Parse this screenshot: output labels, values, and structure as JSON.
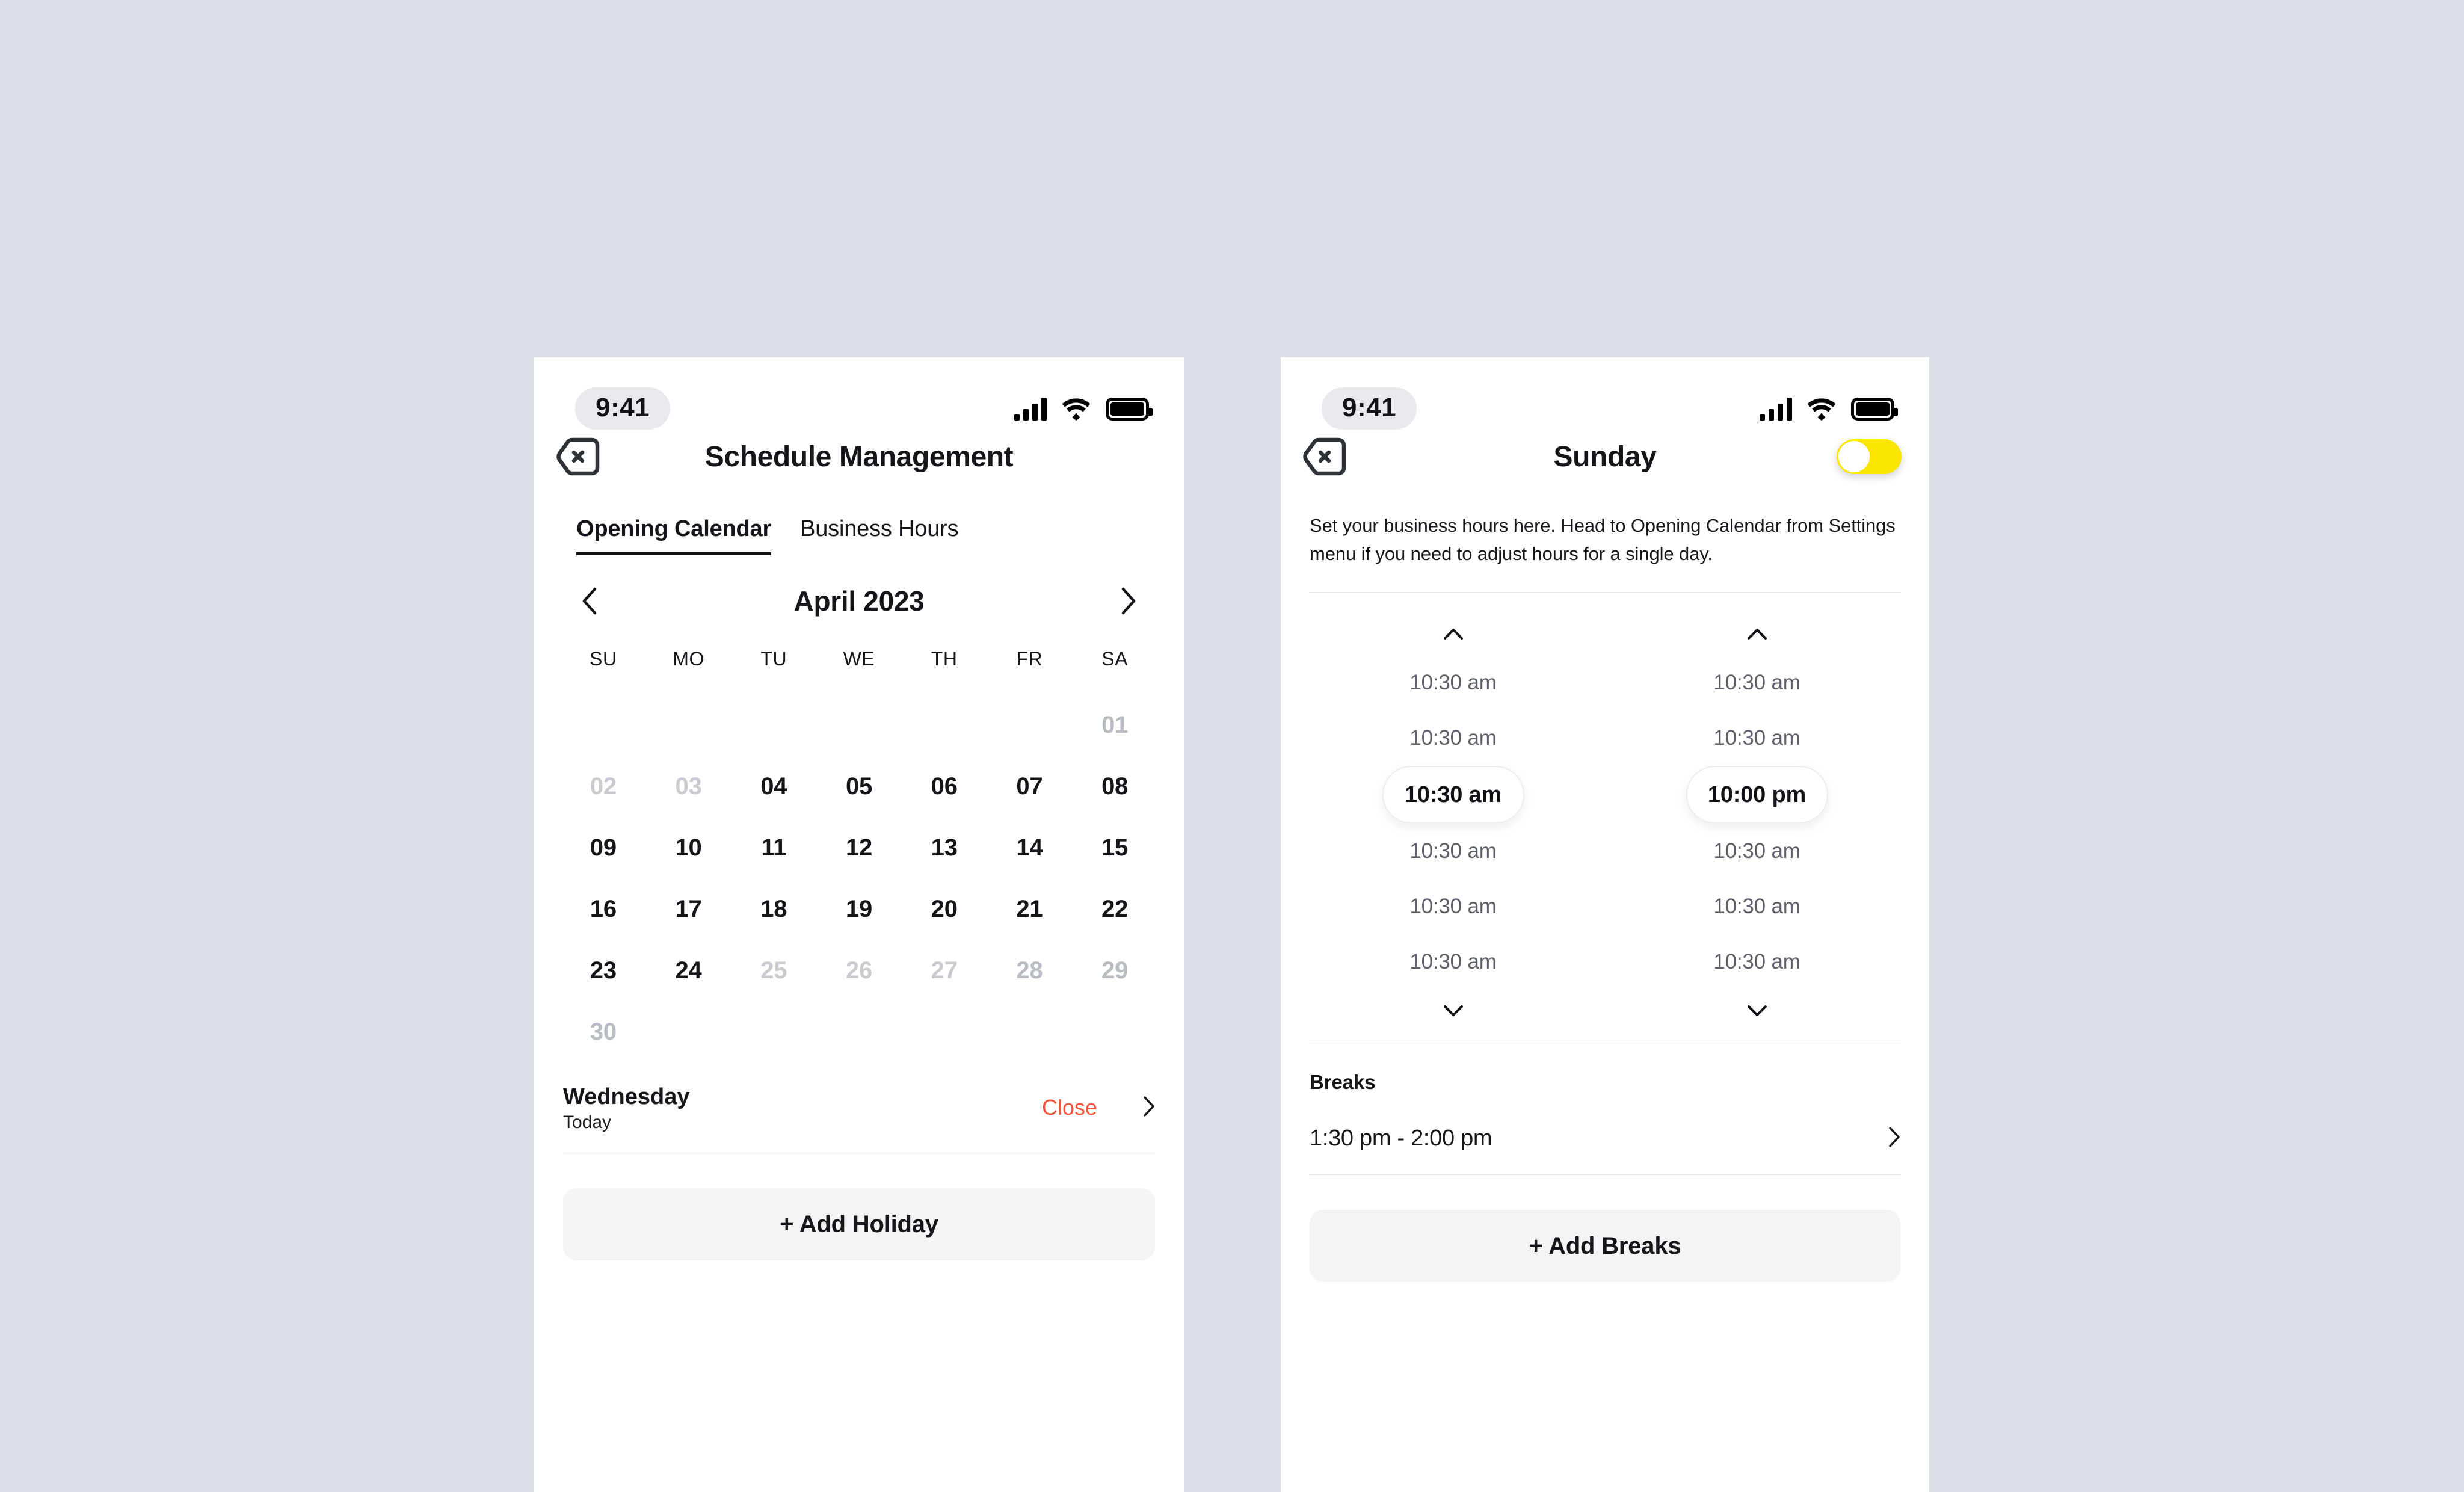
{
  "theme": {
    "background": "#dcdfe6",
    "panel": "#ffffff",
    "accent_yellow": "#fbe600",
    "danger_red": "#f4523b",
    "muted_gray": "#c9cbd0",
    "surface_gray": "#f4f4f5"
  },
  "left_phone": {
    "status_bar": {
      "time": "9:41",
      "icons": [
        "signal-bars-icon",
        "wifi-icon",
        "battery-icon"
      ]
    },
    "nav": {
      "close_icon": "close-tag-icon",
      "title": "Schedule Management"
    },
    "tabs": [
      {
        "label": "Opening Calendar",
        "active": true
      },
      {
        "label": "Business Hours",
        "active": false
      }
    ],
    "calendar": {
      "prev_icon": "chevron-left-icon",
      "next_icon": "chevron-right-icon",
      "month_label": "April 2023",
      "weekday_headers": [
        "SU",
        "MO",
        "TU",
        "WE",
        "TH",
        "FR",
        "SA"
      ],
      "weeks": [
        [
          {
            "label": "",
            "state": "empty"
          },
          {
            "label": "",
            "state": "empty"
          },
          {
            "label": "",
            "state": "empty"
          },
          {
            "label": "",
            "state": "empty"
          },
          {
            "label": "",
            "state": "empty"
          },
          {
            "label": "",
            "state": "empty"
          },
          {
            "label": "01",
            "state": "muted2"
          }
        ],
        [
          {
            "label": "02",
            "state": "muted"
          },
          {
            "label": "03",
            "state": "muted"
          },
          {
            "label": "04",
            "state": "active"
          },
          {
            "label": "05",
            "state": "active"
          },
          {
            "label": "06",
            "state": "active"
          },
          {
            "label": "07",
            "state": "active"
          },
          {
            "label": "08",
            "state": "active"
          }
        ],
        [
          {
            "label": "09",
            "state": "active"
          },
          {
            "label": "10",
            "state": "active"
          },
          {
            "label": "11",
            "state": "active"
          },
          {
            "label": "12",
            "state": "active"
          },
          {
            "label": "13",
            "state": "active"
          },
          {
            "label": "14",
            "state": "active"
          },
          {
            "label": "15",
            "state": "active"
          }
        ],
        [
          {
            "label": "16",
            "state": "active"
          },
          {
            "label": "17",
            "state": "active"
          },
          {
            "label": "18",
            "state": "active"
          },
          {
            "label": "19",
            "state": "active"
          },
          {
            "label": "20",
            "state": "active"
          },
          {
            "label": "21",
            "state": "active"
          },
          {
            "label": "22",
            "state": "active"
          }
        ],
        [
          {
            "label": "23",
            "state": "active"
          },
          {
            "label": "24",
            "state": "active"
          },
          {
            "label": "25",
            "state": "muted"
          },
          {
            "label": "26",
            "state": "muted"
          },
          {
            "label": "27",
            "state": "muted"
          },
          {
            "label": "28",
            "state": "muted2"
          },
          {
            "label": "29",
            "state": "muted2"
          }
        ],
        [
          {
            "label": "30",
            "state": "muted2"
          },
          {
            "label": "",
            "state": "empty"
          },
          {
            "label": "",
            "state": "empty"
          },
          {
            "label": "",
            "state": "empty"
          },
          {
            "label": "",
            "state": "empty"
          },
          {
            "label": "",
            "state": "empty"
          },
          {
            "label": "",
            "state": "empty"
          }
        ]
      ]
    },
    "selected_day_row": {
      "day_name": "Wednesday",
      "subtitle": "Today",
      "status": "Close",
      "chevron_icon": "chevron-right-icon"
    },
    "add_holiday_button": "+ Add Holiday"
  },
  "right_phone": {
    "status_bar": {
      "time": "9:41",
      "icons": [
        "signal-bars-icon",
        "wifi-icon",
        "battery-icon"
      ]
    },
    "nav": {
      "close_icon": "close-tag-icon",
      "title": "Sunday",
      "toggle_state": "on"
    },
    "description": "Set your business hours here. Head to Opening Calendar from Settings menu if you need to adjust hours for a single day.",
    "time_picker": {
      "up_icon": "chevron-up-icon",
      "down_icon": "chevron-down-icon",
      "open_column": {
        "above": [
          "10:30 am",
          "10:30 am"
        ],
        "selected": "10:30 am",
        "below": [
          "10:30 am",
          "10:30 am",
          "10:30 am"
        ]
      },
      "close_column": {
        "above": [
          "10:30 am",
          "10:30 am"
        ],
        "selected": "10:00 pm",
        "below": [
          "10:30 am",
          "10:30 am",
          "10:30 am"
        ]
      }
    },
    "breaks": {
      "title": "Breaks",
      "items": [
        {
          "range": "1:30 pm - 2:00 pm",
          "chevron_icon": "chevron-right-icon"
        }
      ],
      "add_button": "+ Add Breaks"
    }
  }
}
